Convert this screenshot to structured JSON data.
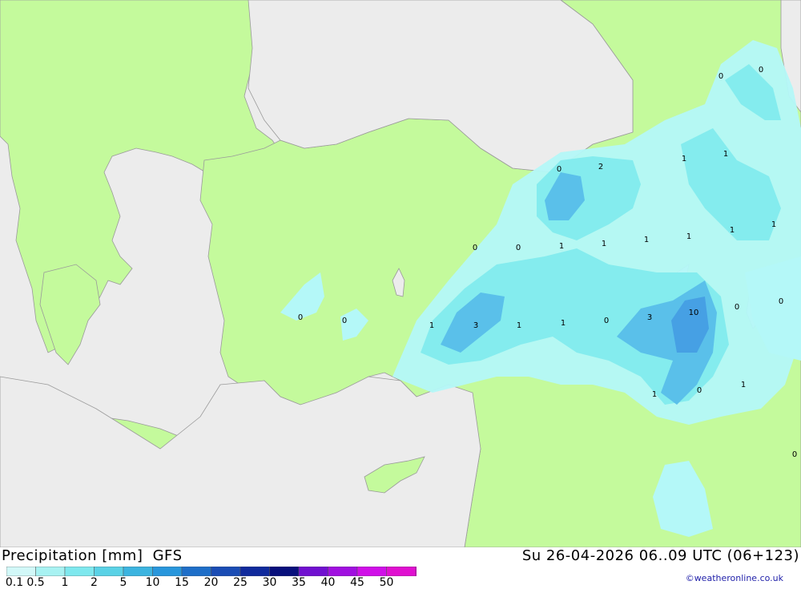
{
  "title": {
    "product": "Precipitation [mm]",
    "model": "GFS"
  },
  "valid_time": "Su 26-04-2026 06..09 UTC (06+123)",
  "credit": "©weatheronline.co.uk",
  "legend": {
    "labels": [
      "0.1",
      "0.5",
      "1",
      "2",
      "5",
      "10",
      "15",
      "20",
      "25",
      "30",
      "35",
      "40",
      "45",
      "50"
    ],
    "colors": [
      "#d2f8f8",
      "#a8f2f2",
      "#7ee8ee",
      "#5ad2e6",
      "#3cb4e0",
      "#2896dc",
      "#1e6ec8",
      "#1a4cb4",
      "#102a9c",
      "#08107c",
      "#7010d0",
      "#a010e0",
      "#d010e8",
      "#e010d0",
      "#b010a8"
    ]
  },
  "colors": {
    "land": "#c4fa9c",
    "sea": "#ececec",
    "precip_light": "#b4f8f8",
    "precip_mid": "#84ecee",
    "precip_heavy": "#5ac0ea",
    "precip_max": "#46a0e4"
  },
  "map_values": [
    {
      "text": "0"
    },
    {
      "text": "0"
    },
    {
      "text": "0"
    },
    {
      "text": "2"
    },
    {
      "text": "1"
    },
    {
      "text": "1"
    },
    {
      "text": "0"
    },
    {
      "text": "0"
    },
    {
      "text": "1"
    },
    {
      "text": "1"
    },
    {
      "text": "1"
    },
    {
      "text": "1"
    },
    {
      "text": "1"
    },
    {
      "text": "1"
    },
    {
      "text": "0"
    },
    {
      "text": "0"
    },
    {
      "text": "1"
    },
    {
      "text": "3"
    },
    {
      "text": "1"
    },
    {
      "text": "1"
    },
    {
      "text": "0"
    },
    {
      "text": "3"
    },
    {
      "text": "10"
    },
    {
      "text": "0"
    },
    {
      "text": "0"
    },
    {
      "text": "1"
    },
    {
      "text": "0"
    },
    {
      "text": "1"
    },
    {
      "text": "0"
    }
  ]
}
